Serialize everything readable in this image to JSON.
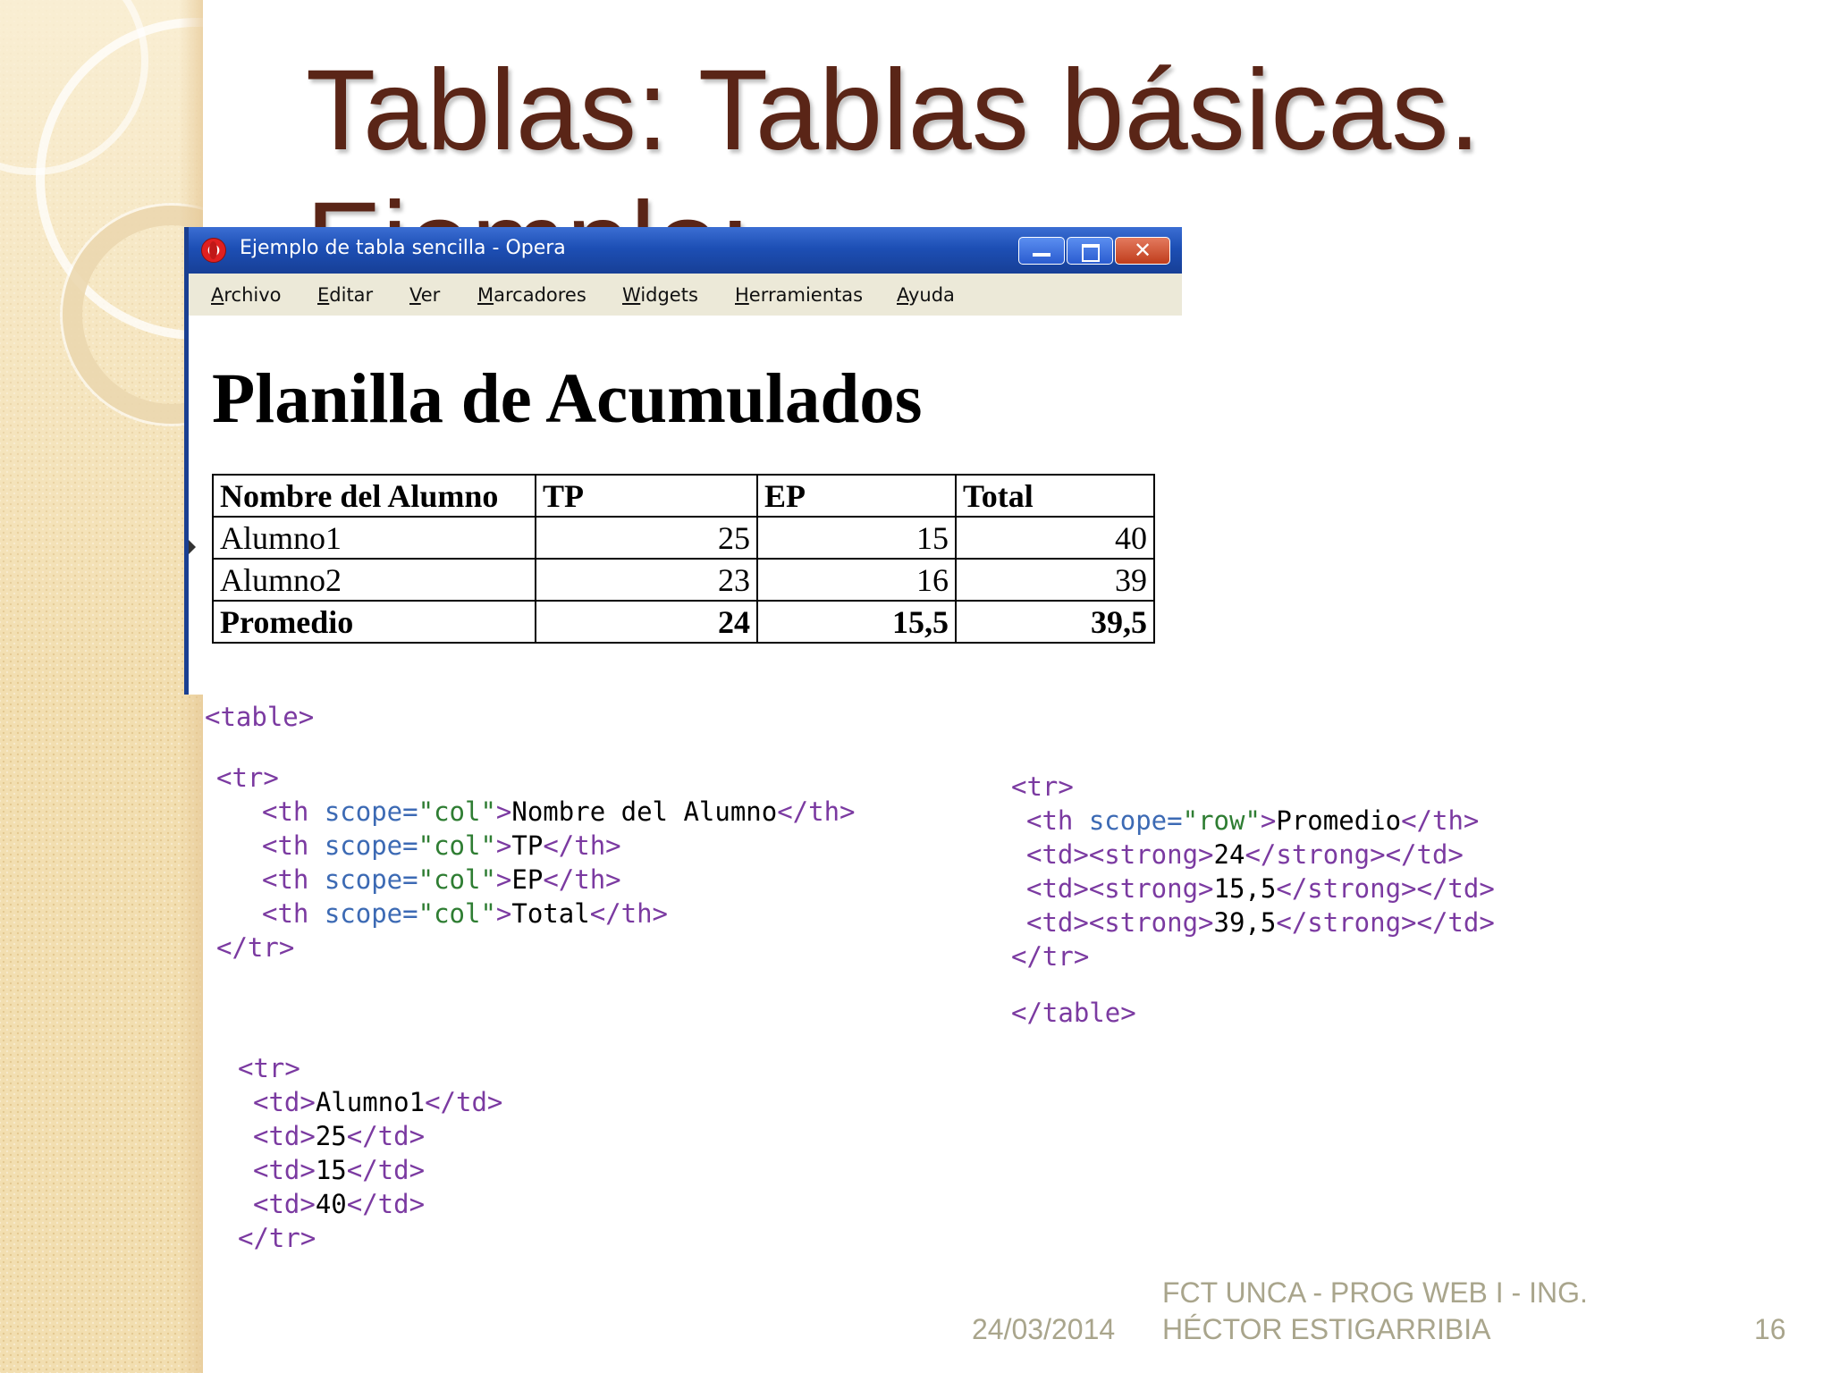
{
  "slide": {
    "title": "Tablas: Tablas básicas. Ejemplo:",
    "footer_date": "24/03/2014",
    "footer_credit": "FCT UNCA - PROG WEB I - ING. HÉCTOR ESTIGARRIBIA",
    "page_number": "16"
  },
  "window": {
    "title": "Ejemplo de tabla sencilla - Opera",
    "menu": [
      "Archivo",
      "Editar",
      "Ver",
      "Marcadores",
      "Widgets",
      "Herramientas",
      "Ayuda"
    ],
    "icons": [
      "opera-icon",
      "minimize-icon",
      "maximize-icon",
      "close-icon"
    ]
  },
  "page": {
    "heading": "Planilla de Acumulados",
    "table": {
      "headers": [
        "Nombre del Alumno",
        "TP",
        "EP",
        "Total"
      ],
      "rows": [
        [
          "Alumno1",
          "25",
          "15",
          "40"
        ],
        [
          "Alumno2",
          "23",
          "16",
          "39"
        ]
      ],
      "summary": [
        "Promedio",
        "24",
        "15,5",
        "39,5"
      ]
    }
  },
  "code": {
    "table_open": "<table>",
    "tr_open": "<tr>",
    "tr_close": "</tr>",
    "table_close": "</table>",
    "header_rows": [
      {
        "open": "<th ",
        "attr": "scope=",
        "val": "\"col\"",
        "close_open": ">",
        "text": "Nombre del Alumno",
        "end": "</th>"
      },
      {
        "open": "<th ",
        "attr": "scope=",
        "val": "\"col\"",
        "close_open": ">",
        "text": "TP",
        "end": "</th>"
      },
      {
        "open": "<th ",
        "attr": "scope=",
        "val": "\"col\"",
        "close_open": ">",
        "text": "EP",
        "end": "</th>"
      },
      {
        "open": "<th ",
        "attr": "scope=",
        "val": "\"col\"",
        "close_open": ">",
        "text": "Total",
        "end": "</th>"
      }
    ],
    "data_rows": [
      {
        "open": "<td>",
        "text": "Alumno1",
        "end": "</td>"
      },
      {
        "open": "<td>",
        "text": "25",
        "end": "</td>"
      },
      {
        "open": "<td>",
        "text": "15",
        "end": "</td>"
      },
      {
        "open": "<td>",
        "text": "40",
        "end": "</td>"
      }
    ],
    "summary_th": {
      "open": "<th ",
      "attr": "scope=",
      "val": "\"row\"",
      "close_open": ">",
      "text": "Promedio",
      "end": "</th>"
    },
    "summary_rows": [
      {
        "open": "<td><strong>",
        "text": "24",
        "end": "</strong></td>"
      },
      {
        "open": "<td><strong>",
        "text": "15,5",
        "end": "</strong></td>"
      },
      {
        "open": "<td><strong>",
        "text": "39,5",
        "end": "</strong></td>"
      }
    ]
  }
}
